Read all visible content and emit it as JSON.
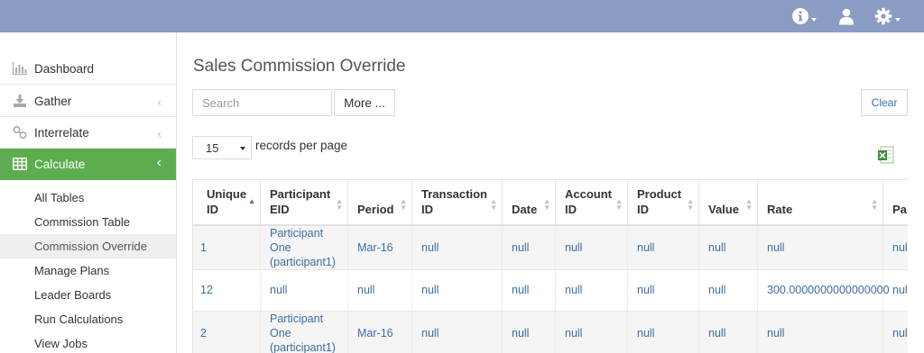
{
  "header": {
    "info_icon": "info-circle-icon",
    "user_icon": "user-icon",
    "settings_icon": "gear-icon"
  },
  "sidebar": {
    "items": [
      {
        "label": "Dashboard",
        "icon": "bar-chart-icon"
      },
      {
        "label": "Gather",
        "icon": "download-icon"
      },
      {
        "label": "Interrelate",
        "icon": "link-icon"
      },
      {
        "label": "Calculate",
        "icon": "table-icon"
      }
    ],
    "subitems": [
      "All Tables",
      "Commission Table",
      "Commission Override",
      "Manage Plans",
      "Leader Boards",
      "Run Calculations",
      "View Jobs"
    ],
    "active_subitem": "Commission Override"
  },
  "page": {
    "title": "Sales Commission Override",
    "search_placeholder": "Search",
    "more_label": "More ...",
    "clear_label": "Clear",
    "page_size": "15",
    "records_per_page_label": "records per page",
    "export_icon": "excel-icon"
  },
  "table": {
    "columns": [
      {
        "l1": "Unique",
        "l2": "ID"
      },
      {
        "l1": "Participant",
        "l2": "EID"
      },
      {
        "l1": "",
        "l2": "Period"
      },
      {
        "l1": "Transaction",
        "l2": "ID"
      },
      {
        "l1": "",
        "l2": "Date"
      },
      {
        "l1": "Account",
        "l2": "ID"
      },
      {
        "l1": "Product",
        "l2": "ID"
      },
      {
        "l1": "",
        "l2": "Value"
      },
      {
        "l1": "",
        "l2": "Rate"
      },
      {
        "l1": "",
        "l2": "Pa"
      }
    ],
    "rows": [
      [
        "1",
        "Participant One (participant1)",
        "Mar-16",
        "null",
        "null",
        "null",
        "null",
        "null",
        "null",
        "null"
      ],
      [
        "12",
        "null",
        "null",
        "null",
        "null",
        "null",
        "null",
        "null",
        "300.0000000000000000",
        "null"
      ],
      [
        "2",
        "Participant One (participant1)",
        "Mar-16",
        "null",
        "null",
        "null",
        "null",
        "null",
        "null",
        "null"
      ]
    ]
  }
}
